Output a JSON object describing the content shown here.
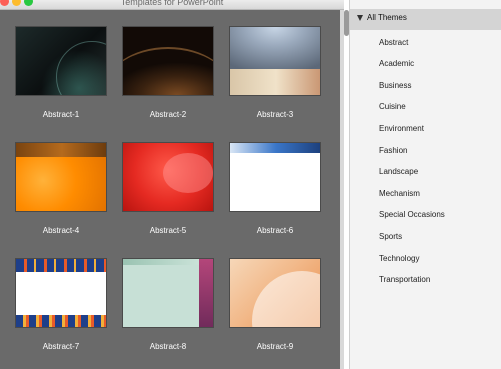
{
  "window": {
    "title": "Templates for PowerPoint"
  },
  "gallery": {
    "templates": [
      {
        "name": "Abstract-1"
      },
      {
        "name": "Abstract-2"
      },
      {
        "name": "Abstract-3"
      },
      {
        "name": "Abstract-4"
      },
      {
        "name": "Abstract-5"
      },
      {
        "name": "Abstract-6"
      },
      {
        "name": "Abstract-7"
      },
      {
        "name": "Abstract-8"
      },
      {
        "name": "Abstract-9"
      }
    ]
  },
  "sidebar": {
    "header": "All Themes",
    "items": [
      {
        "label": "Abstract"
      },
      {
        "label": "Academic"
      },
      {
        "label": "Business"
      },
      {
        "label": "Cuisine"
      },
      {
        "label": "Environment"
      },
      {
        "label": "Fashion"
      },
      {
        "label": "Landscape"
      },
      {
        "label": "Mechanism"
      },
      {
        "label": "Special Occasions"
      },
      {
        "label": "Sports"
      },
      {
        "label": "Technology"
      },
      {
        "label": "Transportation"
      }
    ]
  }
}
